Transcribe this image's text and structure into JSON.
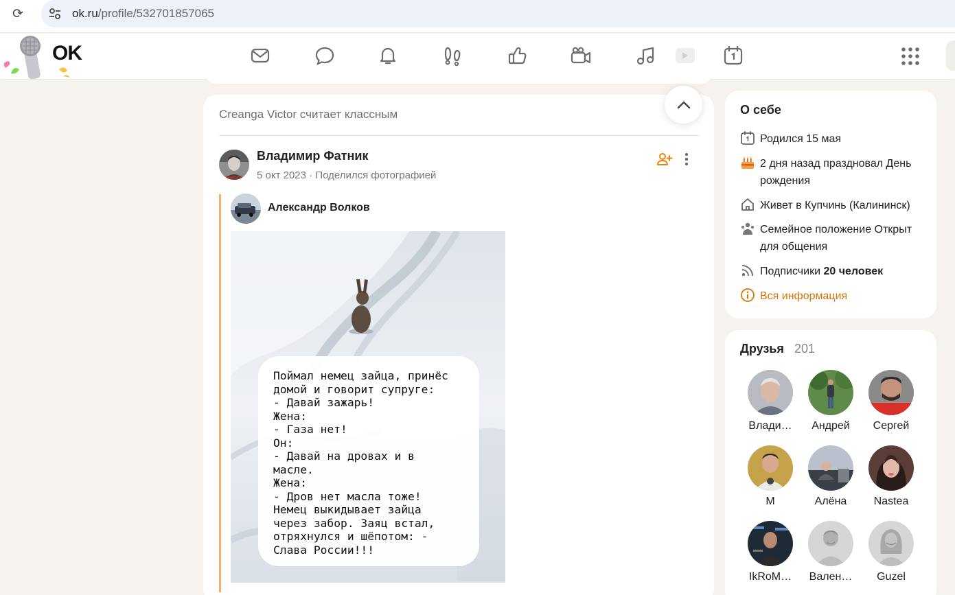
{
  "browser": {
    "url_host": "ok.ru",
    "url_path": "/profile/532701857065",
    "icons": {
      "reload": "reload-icon",
      "site_settings": "site-settings-icon"
    }
  },
  "header": {
    "logo_text": "OK",
    "nav_icons": [
      "messages-icon",
      "discussions-icon",
      "notifications-icon",
      "guests-icon",
      "likes-icon",
      "video-call-icon",
      "music-icon",
      "video-icon",
      "calendar-icon"
    ],
    "apps_icon": "apps-grid-icon",
    "accent_color": "#ee8208"
  },
  "feed": {
    "post": {
      "liked_by": "Creanga Victor считает классным",
      "author": "Владимир Фатник",
      "date": "5 окт 2023",
      "meta_separator": "·",
      "action": "Поделился фотографией",
      "repost_author": "Александр Волков",
      "photo_text": [
        "Поймал немец зайца, принёс",
        "домой и говорит супруге:",
        "- Давай зажарь!",
        "Жена:",
        "- Газа нет!",
        "Он:",
        "- Давай на дровах и в",
        "масле.",
        "Жена:",
        "- Дров нет масла тоже!",
        "Немец выкидывает зайца",
        "через забор. Заяц встал,",
        "отряхнулся и шёпотом: -",
        "Слава России!!!"
      ],
      "footer_cut": "...",
      "icons": {
        "add_friend": "add-friend-icon",
        "more": "more-vertical-icon",
        "scroll_top": "chevron-up-icon"
      }
    }
  },
  "about": {
    "title": "О себе",
    "items": [
      {
        "icon": "calendar-icon",
        "text": "Родился 15 мая"
      },
      {
        "icon": "cake-icon",
        "text": "2 дня назад праздновал День рождения"
      },
      {
        "icon": "home-icon",
        "text": "Живет в Купчинь (Калининск)"
      },
      {
        "icon": "family-icon",
        "text": "Семейное положение Открыт для общения"
      },
      {
        "icon": "rss-icon",
        "text_prefix": "Подписчики ",
        "text_bold": "20 человек"
      },
      {
        "icon": "info-icon",
        "text": "Вся информация"
      }
    ]
  },
  "friends": {
    "title": "Друзья",
    "count": "201",
    "list": [
      {
        "name": "Влади…"
      },
      {
        "name": "Андрей"
      },
      {
        "name": "Сергей"
      },
      {
        "name": "M"
      },
      {
        "name": "Алёна"
      },
      {
        "name": "Nastea"
      },
      {
        "name": "IkRoM…"
      },
      {
        "name": "Вален…"
      },
      {
        "name": "Guzel"
      }
    ]
  }
}
